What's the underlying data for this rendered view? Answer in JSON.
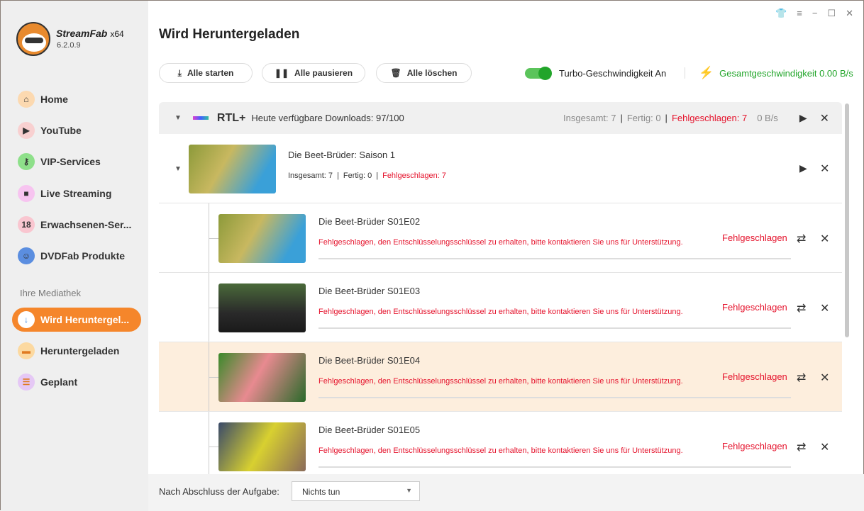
{
  "app": {
    "brand": "StreamFab",
    "arch": "x64",
    "version": "6.2.0.9"
  },
  "sidebar": {
    "items": [
      {
        "label": "Home",
        "icon": "home-icon",
        "color": "#fcd9b0",
        "glyph": "⌂"
      },
      {
        "label": "YouTube",
        "icon": "youtube-icon",
        "color": "#f8d0d0",
        "glyph": "▶"
      },
      {
        "label": "VIP-Services",
        "icon": "key-icon",
        "color": "#8ee08a",
        "glyph": "⚷"
      },
      {
        "label": "Live Streaming",
        "icon": "camera-icon",
        "color": "#f7c4f0",
        "glyph": "■"
      },
      {
        "label": "Erwachsenen-Ser...",
        "icon": "adult-icon",
        "color": "#f9c6d0",
        "glyph": "18"
      },
      {
        "label": "DVDFab Produkte",
        "icon": "dvdfab-icon",
        "color": "#5b8ee0",
        "glyph": "☺"
      }
    ],
    "section": "Ihre Mediathek",
    "library": [
      {
        "label": "Wird Heruntergel...",
        "icon": "download-icon",
        "color": "#ffffff",
        "glyph": "↓"
      },
      {
        "label": "Heruntergeladen",
        "icon": "folder-icon",
        "color": "#fcd9a0",
        "glyph": "▬"
      },
      {
        "label": "Geplant",
        "icon": "list-icon",
        "color": "#e5c8f5",
        "glyph": "☰"
      }
    ]
  },
  "header": {
    "title": "Wird Heruntergeladen",
    "start_all": "Alle starten",
    "pause_all": "Alle pausieren",
    "delete_all": "Alle löschen",
    "turbo": "Turbo-Geschwindigkeit An",
    "total_speed": "Gesamtgeschwindigkeit 0.00 B/s"
  },
  "group": {
    "service": "RTL+",
    "available": "Heute verfügbare Downloads: 97/100",
    "total": "Insgesamt: 7",
    "done": "Fertig: 0",
    "failed": "Fehlgeschlagen: 7",
    "speed": "0 B/s"
  },
  "season": {
    "title": "Die Beet-Brüder: Saison 1",
    "total_label": "Insgesamt:",
    "total": "7",
    "done_label": "Fertig:",
    "done": "0",
    "failed": "Fehlgeschlagen: 7"
  },
  "episodes": [
    {
      "title": "Die Beet-Brüder S01E02",
      "error": "Fehlgeschlagen, den Entschlüsselungsschlüssel zu erhalten, bitte kontaktieren Sie uns für Unterstützung.",
      "status": "Fehlgeschlagen"
    },
    {
      "title": "Die Beet-Brüder S01E03",
      "error": "Fehlgeschlagen, den Entschlüsselungsschlüssel zu erhalten, bitte kontaktieren Sie uns für Unterstützung.",
      "status": "Fehlgeschlagen"
    },
    {
      "title": "Die Beet-Brüder S01E04",
      "error": "Fehlgeschlagen, den Entschlüsselungsschlüssel zu erhalten, bitte kontaktieren Sie uns für Unterstützung.",
      "status": "Fehlgeschlagen"
    },
    {
      "title": "Die Beet-Brüder S01E05",
      "error": "Fehlgeschlagen, den Entschlüsselungsschlüssel zu erhalten, bitte kontaktieren Sie uns für Unterstützung.",
      "status": "Fehlgeschlagen"
    }
  ],
  "footer": {
    "label": "Nach Abschluss der Aufgabe:",
    "action": "Nichts tun"
  }
}
